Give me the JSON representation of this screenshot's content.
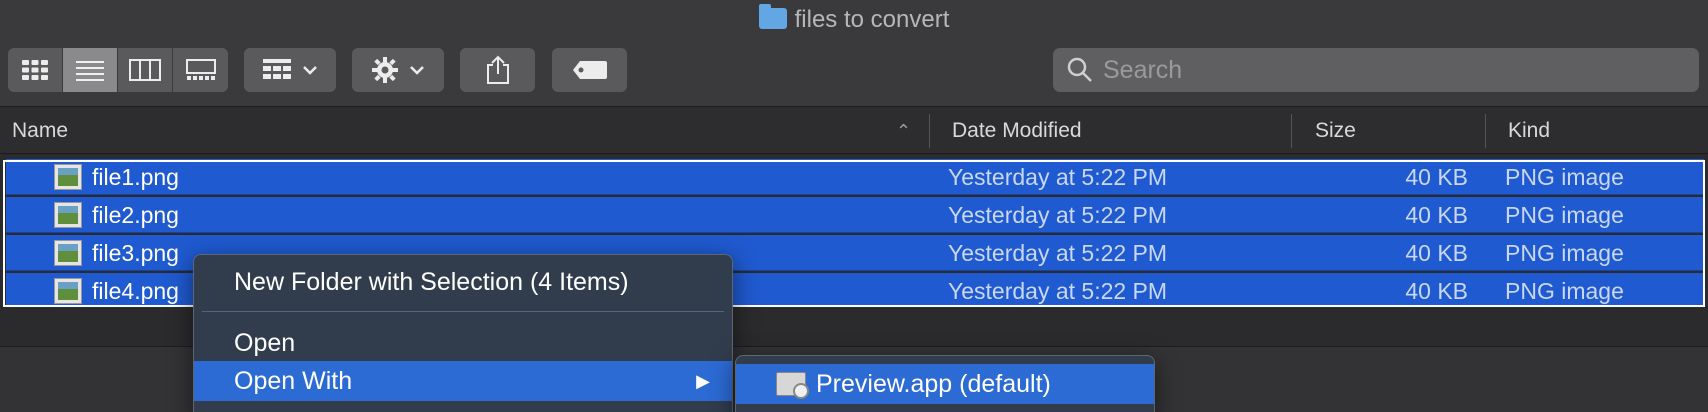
{
  "window": {
    "title": "files to convert"
  },
  "toolbar": {
    "view_modes": [
      "icon-view",
      "list-view",
      "column-view",
      "gallery-view"
    ],
    "group_button": "group-by",
    "action_button": "action",
    "share_button": "share",
    "tag_button": "tag"
  },
  "search": {
    "placeholder": "Search"
  },
  "columns": {
    "name": "Name",
    "date": "Date Modified",
    "size": "Size",
    "kind": "Kind"
  },
  "files": [
    {
      "name": "file1.png",
      "date": "Yesterday at 5:22 PM",
      "size": "40 KB",
      "kind": "PNG image"
    },
    {
      "name": "file2.png",
      "date": "Yesterday at 5:22 PM",
      "size": "40 KB",
      "kind": "PNG image"
    },
    {
      "name": "file3.png",
      "date": "Yesterday at 5:22 PM",
      "size": "40 KB",
      "kind": "PNG image"
    },
    {
      "name": "file4.png",
      "date": "Yesterday at 5:22 PM",
      "size": "40 KB",
      "kind": "PNG image"
    }
  ],
  "context_menu": {
    "new_folder": "New Folder with Selection (4 Items)",
    "open": "Open",
    "open_with": "Open With"
  },
  "submenu": {
    "preview": "Preview.app (default)"
  },
  "colors": {
    "selection": "#1f5ad0",
    "menu_highlight": "#2c6ad4",
    "folder": "#62a7e3"
  }
}
